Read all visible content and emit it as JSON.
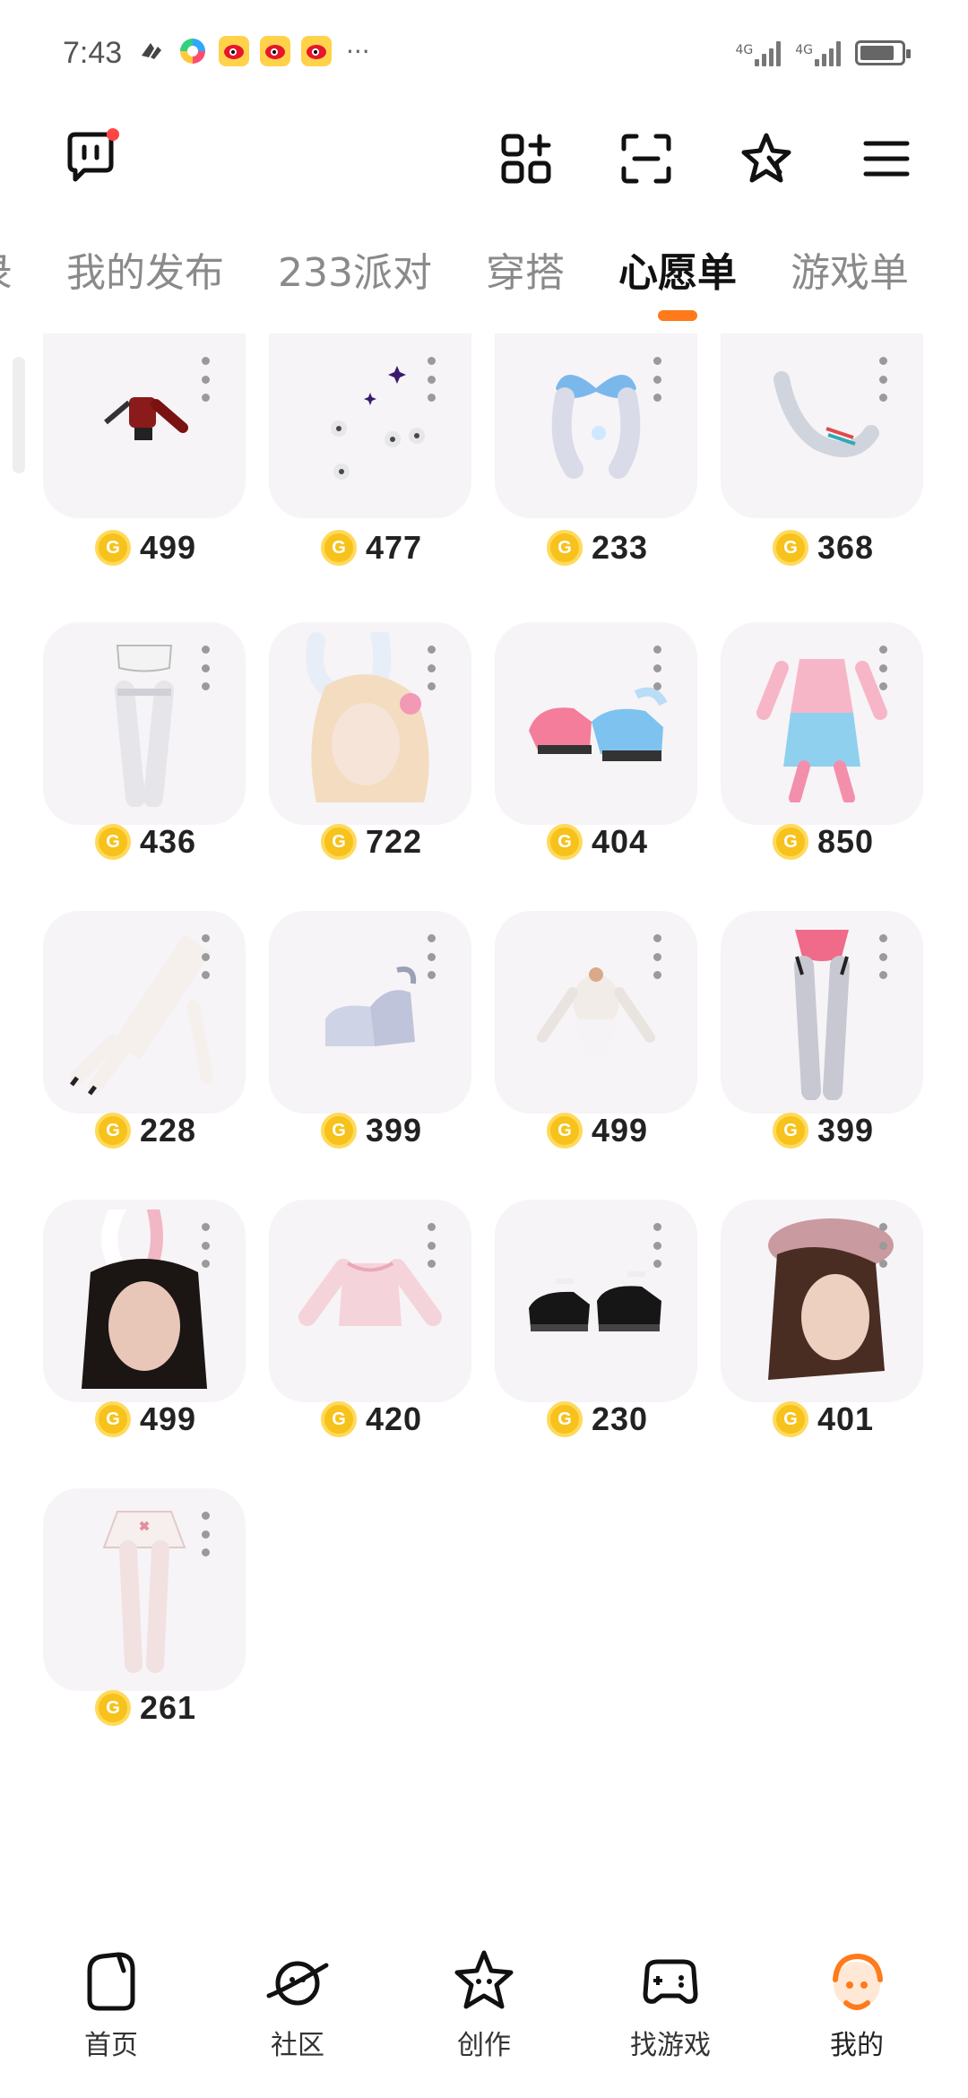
{
  "status_bar": {
    "time": "7:43",
    "more": "···",
    "net_1": "4G",
    "net_2": "4G",
    "battery_level": 0.85
  },
  "tabs": [
    {
      "label": "录",
      "active": false
    },
    {
      "label": "我的发布",
      "active": false
    },
    {
      "label": "233派对",
      "active": false
    },
    {
      "label": "穿搭",
      "active": false
    },
    {
      "label": "心愿单",
      "active": true
    },
    {
      "label": "游戏单",
      "active": false
    }
  ],
  "items": [
    {
      "price": "499",
      "art": "red-top-icon"
    },
    {
      "price": "477",
      "art": "sparkle-effect-icon"
    },
    {
      "price": "233",
      "art": "blue-bow-icon"
    },
    {
      "price": "368",
      "art": "feather-accessory-icon"
    },
    {
      "price": "436",
      "art": "white-stockings-icon"
    },
    {
      "price": "722",
      "art": "bunny-blonde-hair-icon"
    },
    {
      "price": "404",
      "art": "pink-blue-shoes-icon"
    },
    {
      "price": "850",
      "art": "pink-outfit-icon"
    },
    {
      "price": "228",
      "art": "white-gloves-icon"
    },
    {
      "price": "399",
      "art": "white-boots-icon"
    },
    {
      "price": "499",
      "art": "bunny-bodysuit-icon"
    },
    {
      "price": "399",
      "art": "garter-stockings-icon"
    },
    {
      "price": "499",
      "art": "bunny-black-hair-icon"
    },
    {
      "price": "420",
      "art": "pink-sweater-icon"
    },
    {
      "price": "230",
      "art": "black-shoes-icon"
    },
    {
      "price": "401",
      "art": "beret-hair-icon"
    },
    {
      "price": "261",
      "art": "white-skirt-icon"
    }
  ],
  "coin_symbol": "G",
  "bottom_nav": [
    {
      "label": "首页",
      "icon": "home-icon",
      "active": false
    },
    {
      "label": "社区",
      "icon": "planet-icon",
      "active": false
    },
    {
      "label": "创作",
      "icon": "star-icon",
      "active": false
    },
    {
      "label": "找游戏",
      "icon": "gamepad-icon",
      "active": false
    },
    {
      "label": "我的",
      "icon": "profile-icon",
      "active": true
    }
  ],
  "colors": {
    "accent": "#ff7a1a",
    "coin": "#f6c21b",
    "card_bg": "#f6f4f7"
  }
}
